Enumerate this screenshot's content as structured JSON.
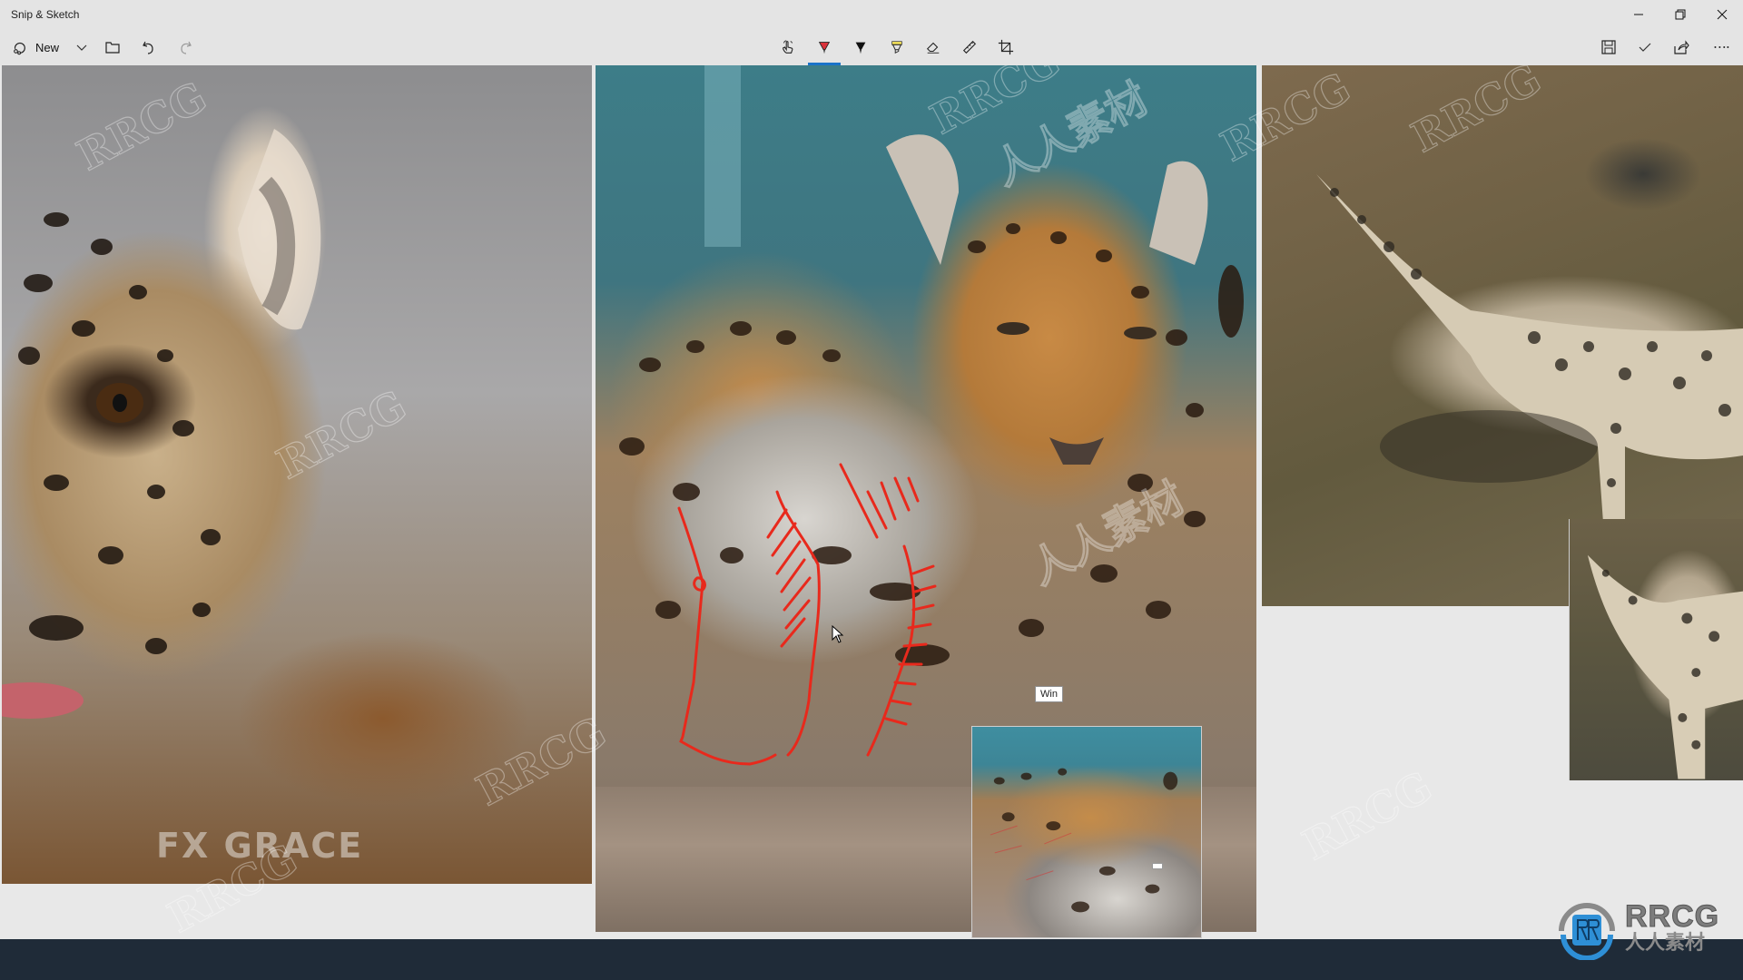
{
  "app": {
    "title": "Snip & Sketch"
  },
  "window_controls": {
    "minimize": "minimize",
    "restore": "restore",
    "close": "close"
  },
  "toolbar": {
    "new_label": "New",
    "left_actions": [
      {
        "name": "new-snip",
        "icon": "snip-icon"
      },
      {
        "name": "new-dropdown",
        "icon": "chevron-down-icon"
      },
      {
        "name": "open-file",
        "icon": "folder-icon"
      },
      {
        "name": "undo",
        "icon": "undo-icon"
      },
      {
        "name": "redo",
        "icon": "redo-icon"
      }
    ],
    "tools": [
      {
        "name": "touch-writing",
        "icon": "touch-writing-icon",
        "active": false
      },
      {
        "name": "ballpoint-pen",
        "icon": "pen-icon",
        "color": "#d9323b",
        "active": true
      },
      {
        "name": "pencil",
        "icon": "pencil-icon",
        "color": "#111111",
        "active": false
      },
      {
        "name": "highlighter",
        "icon": "highlighter-icon",
        "color": "#f2e05a",
        "active": false
      },
      {
        "name": "eraser",
        "icon": "eraser-icon",
        "active": false
      },
      {
        "name": "ruler",
        "icon": "ruler-icon",
        "active": false
      },
      {
        "name": "crop",
        "icon": "crop-icon",
        "active": false
      }
    ],
    "right_actions": [
      {
        "name": "save",
        "icon": "save-icon"
      },
      {
        "name": "copy",
        "icon": "check-icon"
      },
      {
        "name": "share",
        "icon": "share-icon"
      },
      {
        "name": "more",
        "icon": "more-icon"
      }
    ],
    "active_color": "#1a73c9"
  },
  "canvas": {
    "left_image_caption": "FX GRACE",
    "tooltip": "Win",
    "annotation_color": "#e8291c",
    "watermark": "RRCG",
    "watermark_cn": "人人素材"
  },
  "logo": {
    "main": "RRCG",
    "sub": "人人素材",
    "badge_color": "#2e8fd6"
  }
}
